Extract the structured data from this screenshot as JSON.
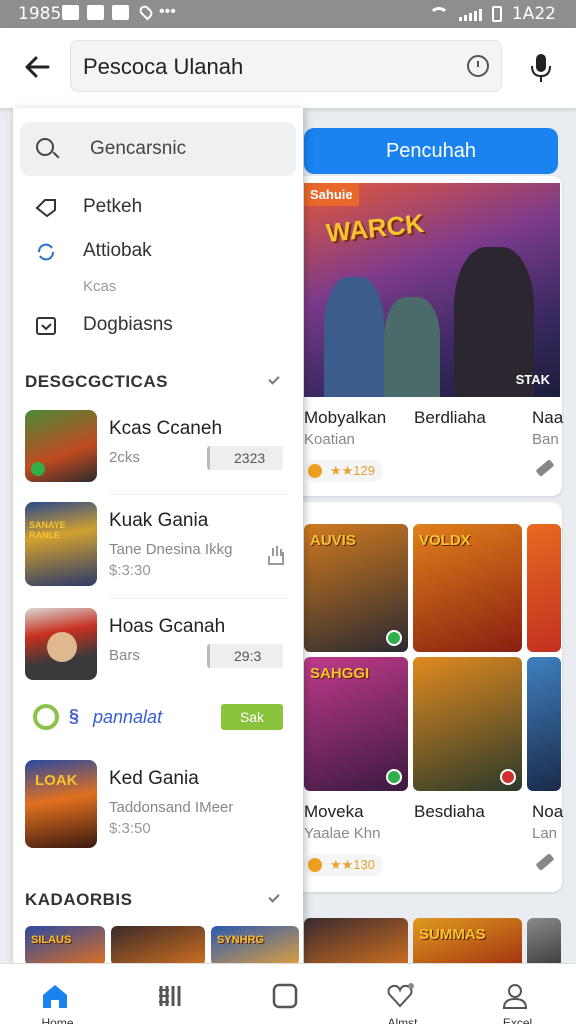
{
  "status_bar": {
    "time_left": "1985",
    "icons": [
      "image-icon",
      "mail-icon",
      "nav-icon",
      "location-icon"
    ],
    "more": "•••",
    "time_right": "1A22"
  },
  "header": {
    "query": "Pescoca Ulanah"
  },
  "right": {
    "blue_button": "Pencuhah",
    "hero": {
      "tag": "Sahuie",
      "logo": "WARCK",
      "brand": "STAK"
    },
    "row1": [
      {
        "title": "Mobyalkan",
        "sub": "Koatian",
        "rating": "★★129"
      },
      {
        "title": "Berdliaha",
        "sub": ""
      },
      {
        "title": "Naa",
        "sub": "Ban"
      }
    ],
    "tiles": [
      "AUVIS",
      "VOLDX",
      "SAHGGI",
      "",
      ""
    ],
    "row2": [
      {
        "title": "Moveka",
        "sub": "Yaalae Khn",
        "rating": "★★130"
      },
      {
        "title": "Besdiaha",
        "sub": ""
      },
      {
        "title": "Noa",
        "sub": "Lan"
      }
    ],
    "bottom_tiles": [
      "",
      "SUMMAS"
    ]
  },
  "dropdown": {
    "search_text": "Gencarsnic",
    "history": [
      {
        "label": "Petkeh"
      },
      {
        "label": "Attiobak"
      }
    ],
    "history_sub": "Kcas",
    "history3": "Dogbiasns",
    "section1": "DESGCGCTICAS",
    "apps": [
      {
        "name": "Kcas Ccaneh",
        "meta": "2cks",
        "size": "2323"
      },
      {
        "name": "Kuak Gania",
        "meta": "Tane Dnesina Ikkg",
        "meta2": "$:3:30",
        "banner": "SANAYE RANLE"
      },
      {
        "name": "Hoas Gcanah",
        "meta": "Bars",
        "size": "29:3"
      }
    ],
    "promo": {
      "text": "pannalat",
      "button": "Sak"
    },
    "app4": {
      "name": "Ked Gania",
      "meta": "Taddonsand IMeer",
      "meta2": "$:3:50",
      "logo": "LOAK"
    },
    "section2": "KADAORBIS",
    "bottom_tiles": [
      "SILAUS",
      "",
      "SYNHRG"
    ]
  },
  "bottom_nav": [
    {
      "label": "Home",
      "icon": "home-icon"
    },
    {
      "label": "",
      "icon": "library-icon"
    },
    {
      "label": "",
      "icon": "square-icon"
    },
    {
      "label": "Almst",
      "icon": "heart-icon"
    },
    {
      "label": "Excel",
      "icon": "profile-icon"
    }
  ],
  "colors": {
    "accent": "#1a83f0",
    "promo_green": "#8ac43d",
    "status_bar": "#8e8e8e"
  }
}
